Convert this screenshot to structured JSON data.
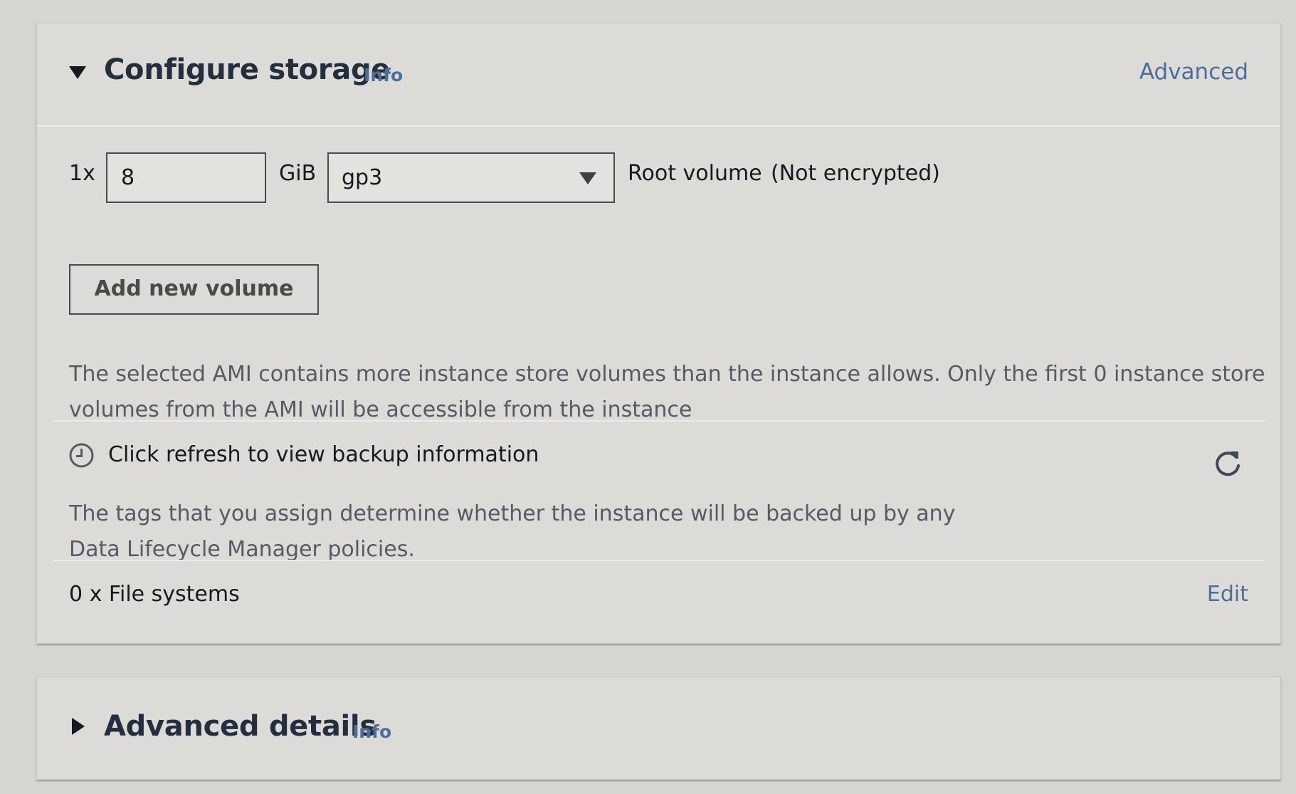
{
  "storage_panel": {
    "title": "Configure storage",
    "info_label": "Info",
    "advanced_label": "Advanced",
    "expanded": true,
    "volume": {
      "count_label": "1x",
      "size_value": "8",
      "unit_label": "GiB",
      "type_selected": "gp3",
      "role_label": "Root volume",
      "encryption_label": "(Not encrypted)"
    },
    "add_volume_label": "Add new volume",
    "ami_message_lines": [
      "The selected AMI contains more instance store volumes than the instance allows. Only the first 0 instance store",
      "volumes from the AMI will be accessible from the instance"
    ],
    "backup": {
      "icon": "clock-icon",
      "title": "Click refresh to view backup information",
      "description_lines": [
        "The tags that you assign determine whether the instance will be backed up by any",
        "Data Lifecycle Manager policies."
      ],
      "refresh_icon": "refresh-icon"
    },
    "file_systems": {
      "label": "0 x File systems",
      "edit_label": "Edit"
    }
  },
  "advanced_panel": {
    "title": "Advanced details",
    "info_label": "Info",
    "expanded": false
  },
  "colors": {
    "background": "#d6d5d1",
    "panel": "#dcdbd7",
    "link": "#4b6f9a",
    "heading": "#232f3e",
    "secondary_text": "#545b64"
  }
}
